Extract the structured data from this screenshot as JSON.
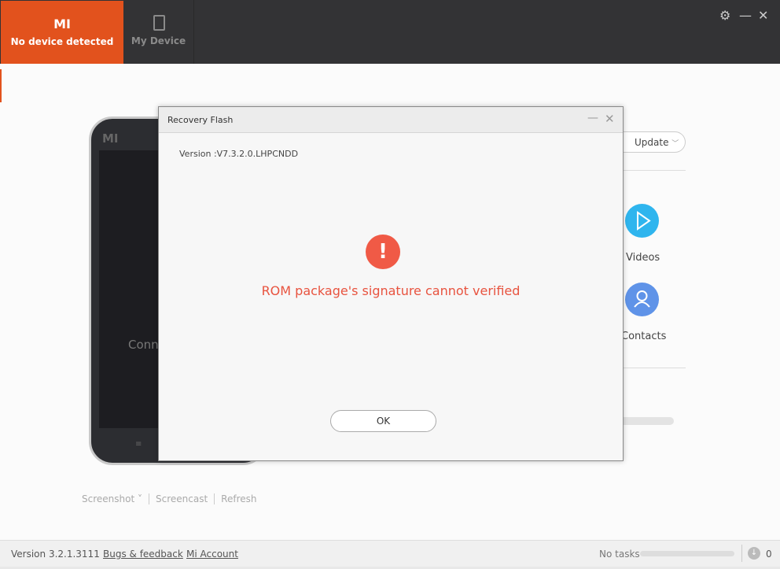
{
  "header": {
    "logo": "MI",
    "tabs": [
      {
        "label": "No device detected"
      },
      {
        "label": "My Device"
      }
    ]
  },
  "phone": {
    "logo": "MI",
    "text": "Connect"
  },
  "dialog": {
    "title": "Recovery Flash",
    "version": "Version :V7.3.2.0.LHPCNDD",
    "message": "ROM package's signature cannot verified",
    "ok": "OK",
    "alert_symbol": "!"
  },
  "right": {
    "update": "Update",
    "videos": "Videos",
    "contacts": "Contacts"
  },
  "tools": {
    "screenshot": "Screenshot",
    "screencast": "Screencast",
    "refresh": "Refresh"
  },
  "status": {
    "version": "Version 3.2.1.3111",
    "bugs": "Bugs & feedback",
    "account": "Mi Account",
    "tasks": "No tasks",
    "count": "0"
  }
}
